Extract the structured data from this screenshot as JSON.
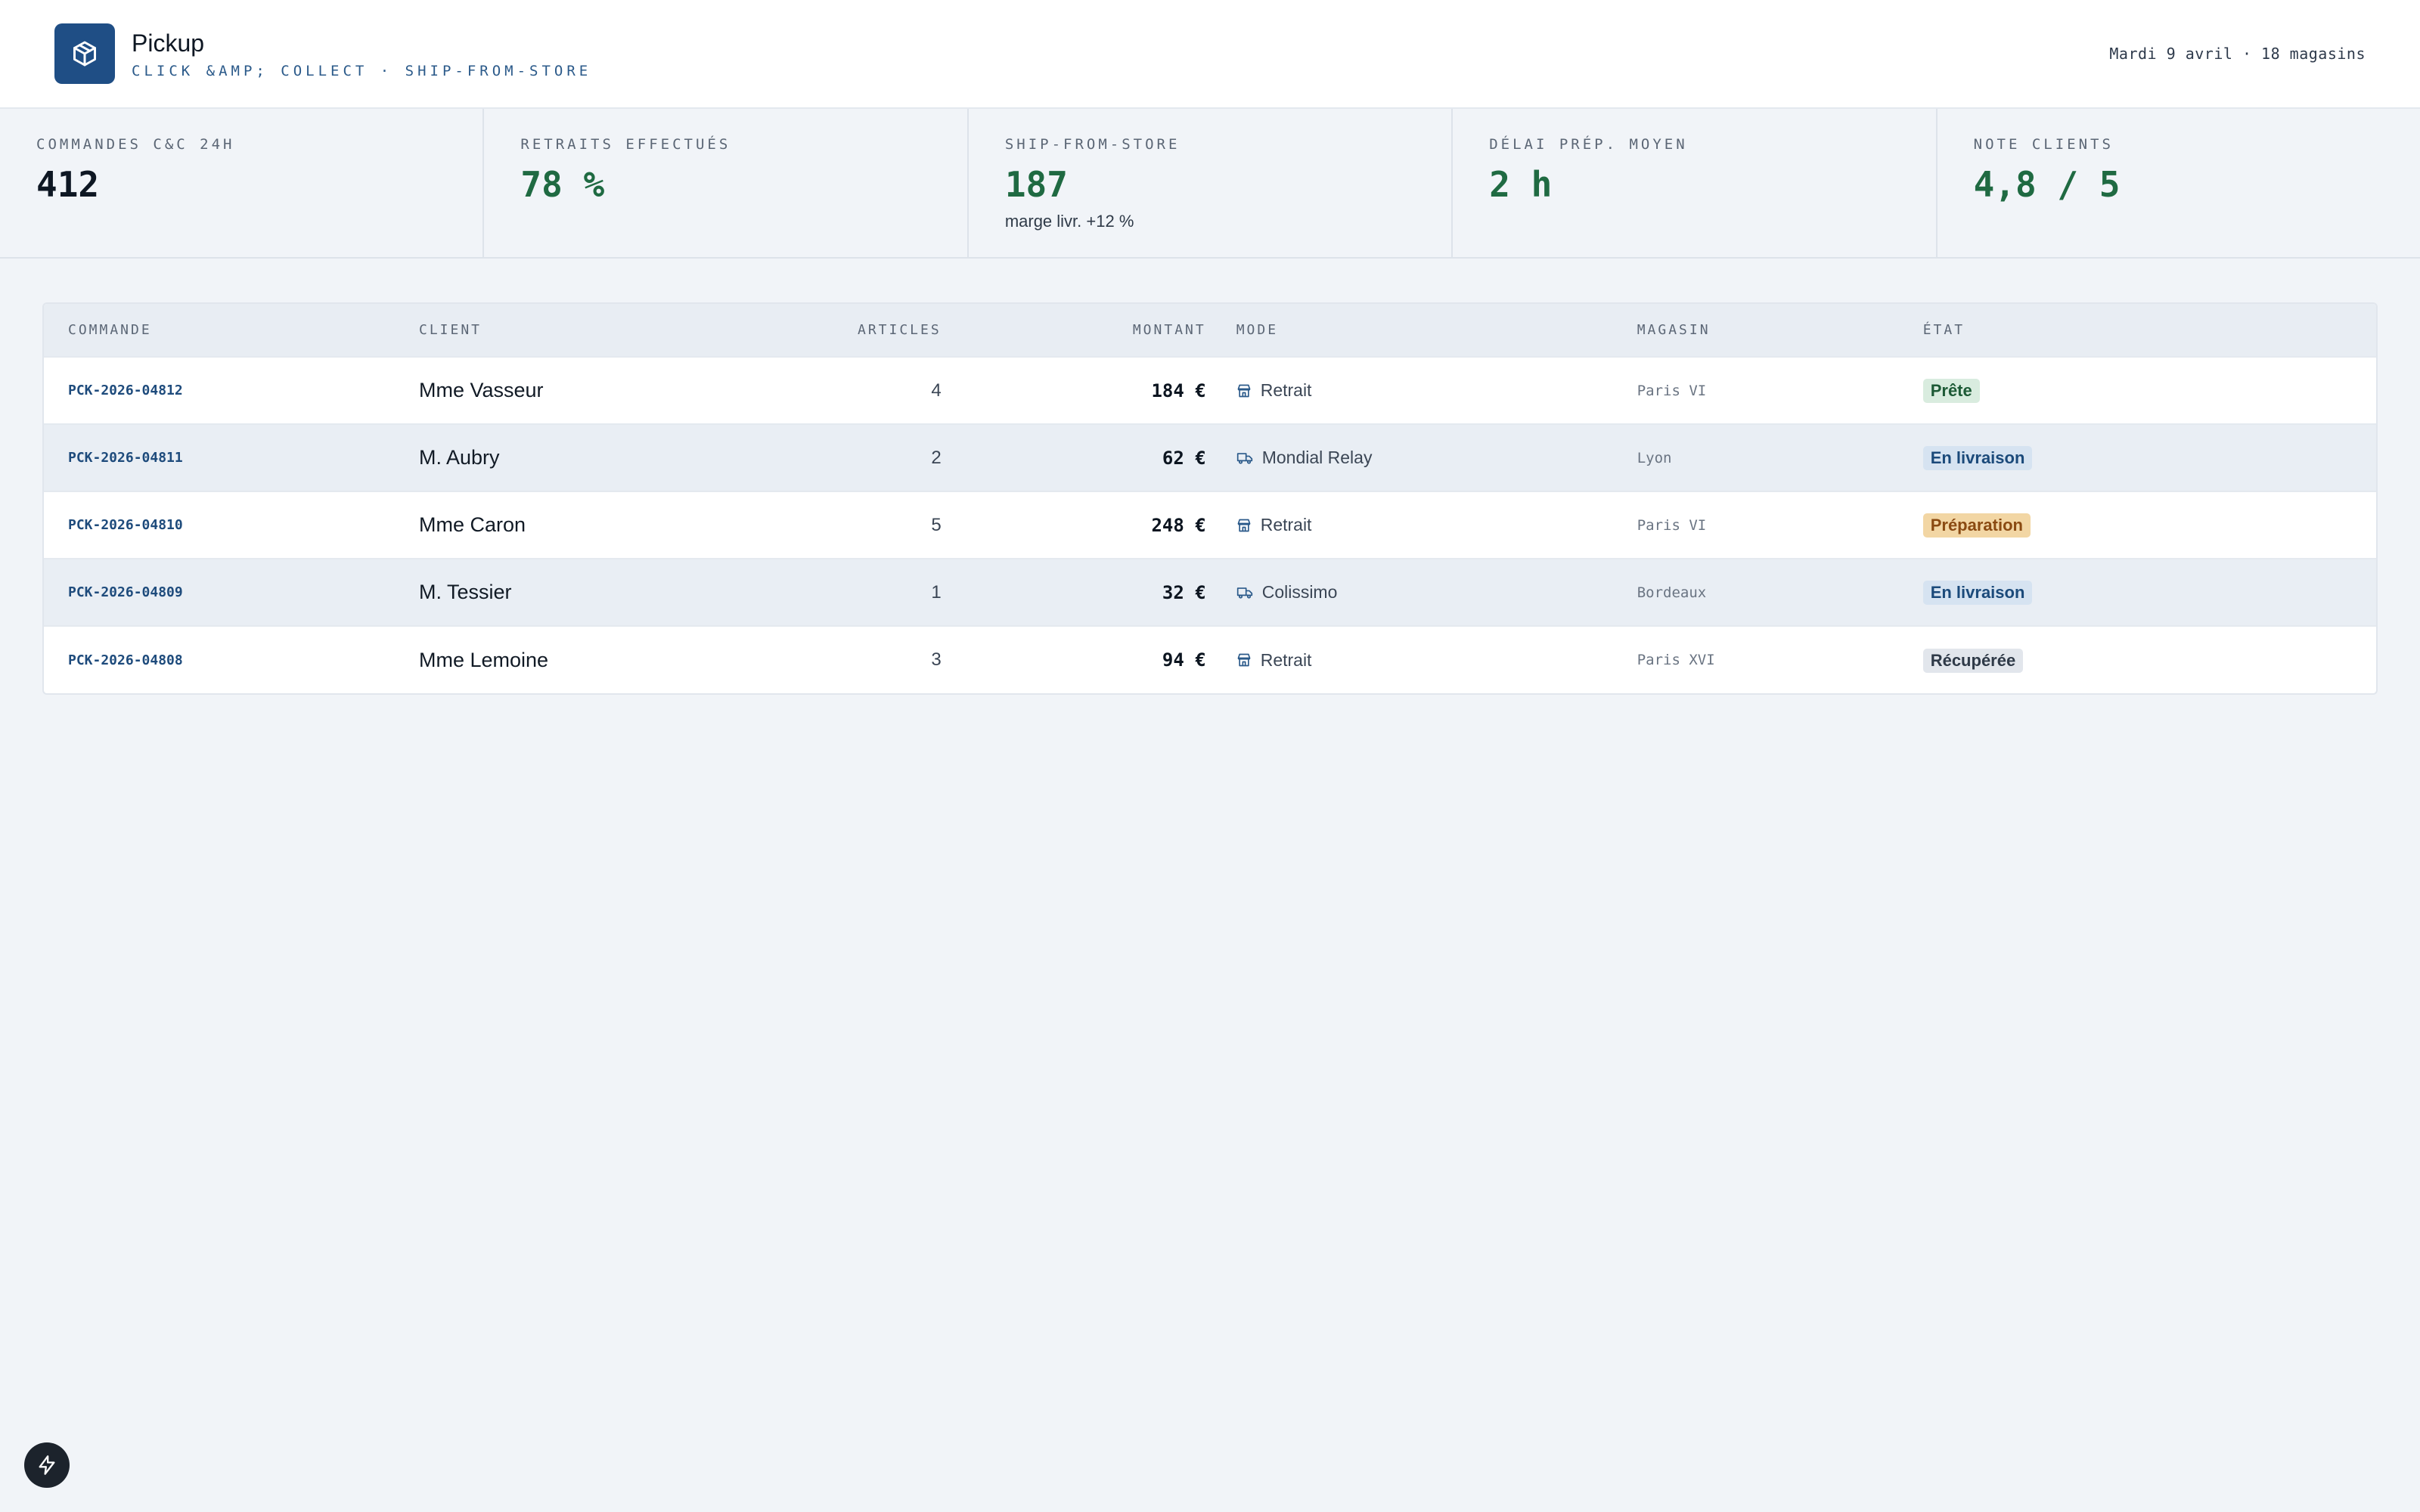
{
  "app": {
    "name": "Pickup",
    "subtitle": "CLICK &AMP; COLLECT · SHIP-FROM-STORE",
    "meta": "Mardi 9 avril · 18 magasins"
  },
  "kpis": [
    {
      "label": "COMMANDES C&C 24H",
      "value": "412",
      "note": "",
      "color": "#0e1723"
    },
    {
      "label": "RETRAITS EFFECTUÉS",
      "value": "78 %",
      "note": "",
      "color": "#1f6a42"
    },
    {
      "label": "SHIP-FROM-STORE",
      "value": "187",
      "note": "marge livr. +12 %",
      "color": "#1f6a42"
    },
    {
      "label": "DÉLAI PRÉP. MOYEN",
      "value": "2 h",
      "note": "",
      "color": "#1f6a42"
    },
    {
      "label": "NOTE CLIENTS",
      "value": "4,8 / 5",
      "note": "",
      "color": "#1f6a42"
    }
  ],
  "table": {
    "headers": {
      "order": "COMMANDE",
      "client": "CLIENT",
      "articles": "ARTICLES",
      "amount": "MONTANT",
      "mode": "MODE",
      "store": "MAGASIN",
      "state": "ÉTAT"
    },
    "rows": [
      {
        "order": "PCK-2026-04812",
        "client": "Mme Vasseur",
        "articles": "4",
        "amount": "184 €",
        "mode": "Retrait",
        "mode_icon": "store-icon",
        "store": "Paris VI",
        "state": "Prête",
        "state_kind": "ready"
      },
      {
        "order": "PCK-2026-04811",
        "client": "M. Aubry",
        "articles": "2",
        "amount": "62 €",
        "mode": "Mondial Relay",
        "mode_icon": "truck-icon",
        "store": "Lyon",
        "state": "En livraison",
        "state_kind": "ship"
      },
      {
        "order": "PCK-2026-04810",
        "client": "Mme Caron",
        "articles": "5",
        "amount": "248 €",
        "mode": "Retrait",
        "mode_icon": "store-icon",
        "store": "Paris VI",
        "state": "Préparation",
        "state_kind": "prep"
      },
      {
        "order": "PCK-2026-04809",
        "client": "M. Tessier",
        "articles": "1",
        "amount": "32 €",
        "mode": "Colissimo",
        "mode_icon": "truck-icon",
        "store": "Bordeaux",
        "state": "En livraison",
        "state_kind": "ship"
      },
      {
        "order": "PCK-2026-04808",
        "client": "Mme Lemoine",
        "articles": "3",
        "amount": "94 €",
        "mode": "Retrait",
        "mode_icon": "store-icon",
        "store": "Paris XVI",
        "state": "Récupérée",
        "state_kind": "done"
      }
    ]
  },
  "colors": {
    "brand": "#1f4e85",
    "accent_green": "#1f6a42"
  }
}
